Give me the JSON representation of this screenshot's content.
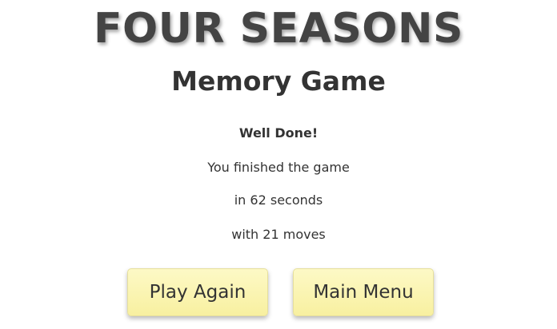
{
  "header": {
    "title": "FOUR SEASONS",
    "subtitle": "Memory Game"
  },
  "result": {
    "heading": "Well Done!",
    "finished": "You finished the game",
    "time": "in 62 seconds",
    "moves": "with 21 moves"
  },
  "buttons": {
    "play_again": "Play Again",
    "main_menu": "Main Menu"
  },
  "colors": {
    "button_fill": "#f8f0a0",
    "title_text": "#444444"
  }
}
